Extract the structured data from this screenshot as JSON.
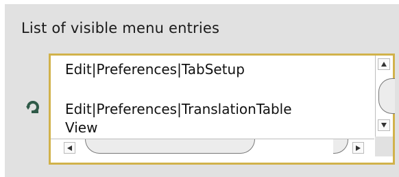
{
  "section": {
    "caption": "List of visible menu entries"
  },
  "menu_entries": [
    "Edit|Preferences|TabSetup",
    "Edit|Preferences|TranslationTable",
    "View"
  ],
  "icons": {
    "reset": "reset-icon",
    "scroll_up": "arrow-up-icon",
    "scroll_down": "arrow-down-icon",
    "scroll_left": "arrow-left-icon",
    "scroll_right": "arrow-right-icon"
  },
  "colors": {
    "panel_background": "#e1e1e1",
    "list_border": "#d1b24a",
    "list_background": "#ffffff"
  }
}
